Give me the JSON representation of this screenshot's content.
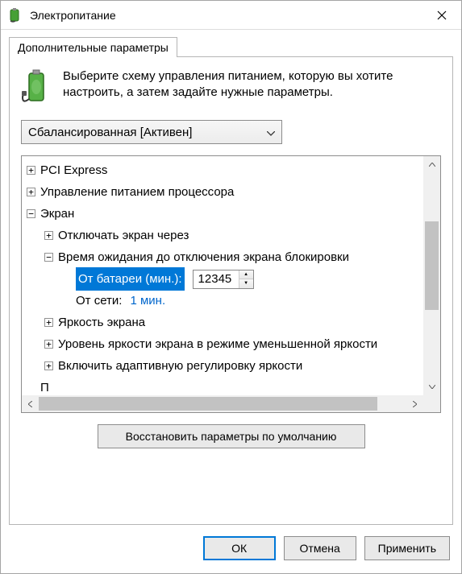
{
  "window": {
    "title": "Электропитание"
  },
  "tab": {
    "label": "Дополнительные параметры"
  },
  "intro": {
    "text": "Выберите схему управления питанием, которую вы хотите настроить, а затем задайте нужные параметры."
  },
  "scheme": {
    "selected": "Сбалансированная [Активен]"
  },
  "tree": {
    "pci": "PCI Express",
    "cpu": "Управление питанием процессора",
    "screen": "Экран",
    "screen_off": "Отключать экран через",
    "lock_timeout": "Время ожидания до отключения экрана блокировки",
    "battery_label": "От батареи (мин.):",
    "battery_value": "12345",
    "plugged_label": "От сети:",
    "plugged_value": "1 мин.",
    "brightness": "Яркость экрана",
    "dim_brightness": "Уровень яркости экрана в режиме уменьшенной яркости",
    "adaptive": "Включить адаптивную регулировку яркости",
    "partial": "П"
  },
  "buttons": {
    "restore": "Восстановить параметры по умолчанию",
    "ok": "ОК",
    "cancel": "Отмена",
    "apply": "Применить"
  },
  "expanders": {
    "plus": "+",
    "minus": "−"
  }
}
